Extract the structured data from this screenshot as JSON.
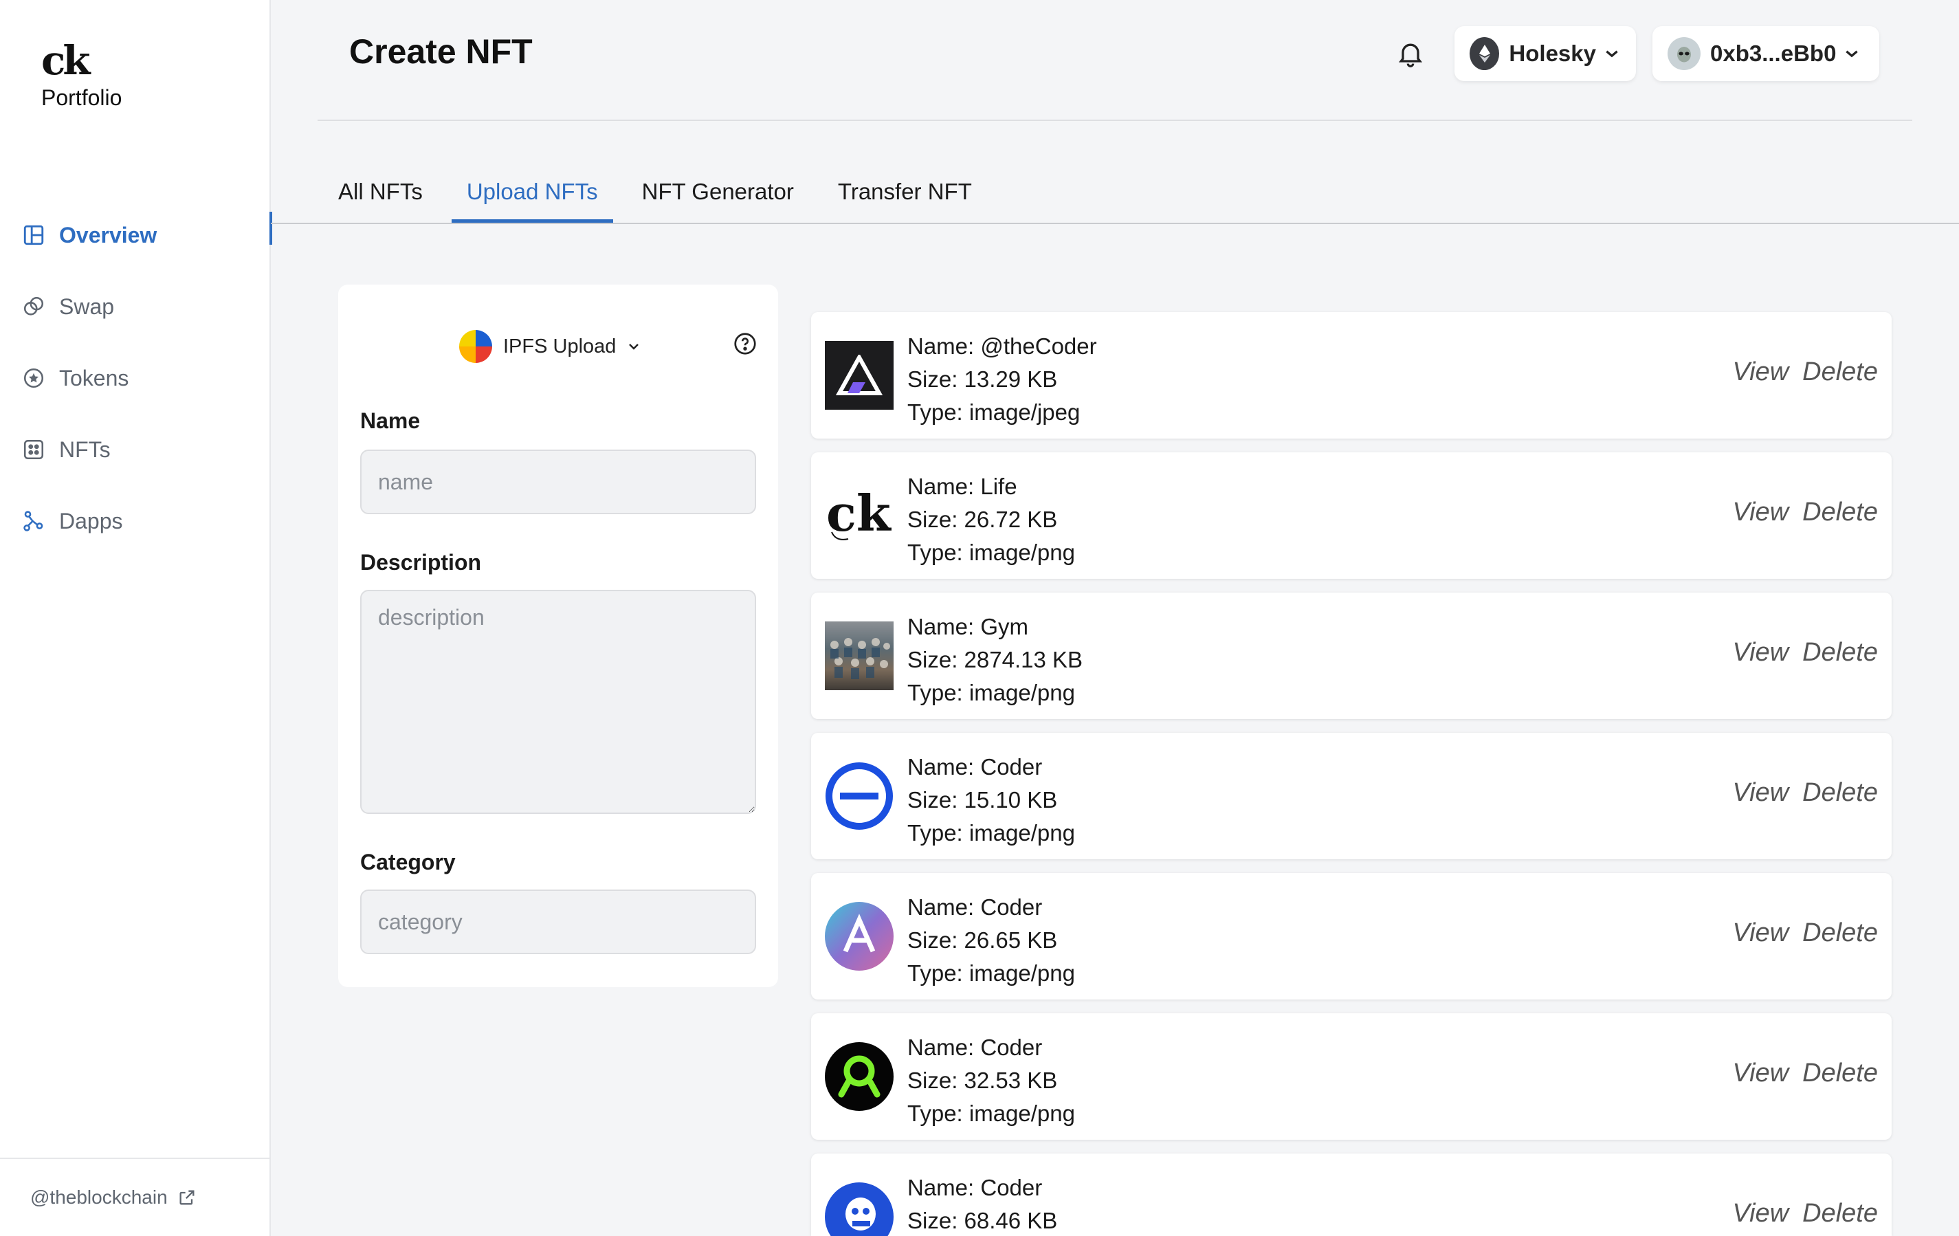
{
  "sidebar": {
    "logo_mark": "ck",
    "logo_text": "Portfolio",
    "items": [
      {
        "label": "Overview",
        "icon": "layout-icon",
        "active": true
      },
      {
        "label": "Swap",
        "icon": "swap-icon"
      },
      {
        "label": "Tokens",
        "icon": "token-icon"
      },
      {
        "label": "NFTs",
        "icon": "grid-icon"
      },
      {
        "label": "Dapps",
        "icon": "network-icon"
      }
    ],
    "footer_link": "@theblockchain"
  },
  "header": {
    "title": "Create NFT",
    "network": "Holesky",
    "account": "0xb3...eBb0"
  },
  "tabs": [
    "All NFTs",
    "Upload NFTs",
    "NFT Generator",
    "Transfer NFT"
  ],
  "active_tab": "Upload NFTs",
  "form": {
    "upload_method": "IPFS Upload",
    "name_label": "Name",
    "name_placeholder": "name",
    "description_label": "Description",
    "description_placeholder": "description",
    "category_label": "Category",
    "category_placeholder": "category"
  },
  "files": [
    {
      "name": "Name: @theCoder",
      "size": "Size: 13.29 KB",
      "type": "Type: image/jpeg"
    },
    {
      "name": "Name: Life",
      "size": "Size: 26.72 KB",
      "type": "Type: image/png"
    },
    {
      "name": "Name: Gym",
      "size": "Size: 2874.13 KB",
      "type": "Type: image/png"
    },
    {
      "name": "Name: Coder",
      "size": "Size: 15.10 KB",
      "type": "Type: image/png"
    },
    {
      "name": "Name: Coder",
      "size": "Size: 26.65 KB",
      "type": "Type: image/png"
    },
    {
      "name": "Name: Coder",
      "size": "Size: 32.53 KB",
      "type": "Type: image/png"
    },
    {
      "name": "Name: Coder",
      "size": "Size: 68.46 KB",
      "type": ""
    }
  ],
  "actions": {
    "view": "View",
    "delete": "Delete"
  },
  "colors": {
    "accent": "#2e6dc1",
    "background": "#f4f5f7",
    "card": "#ffffff"
  }
}
